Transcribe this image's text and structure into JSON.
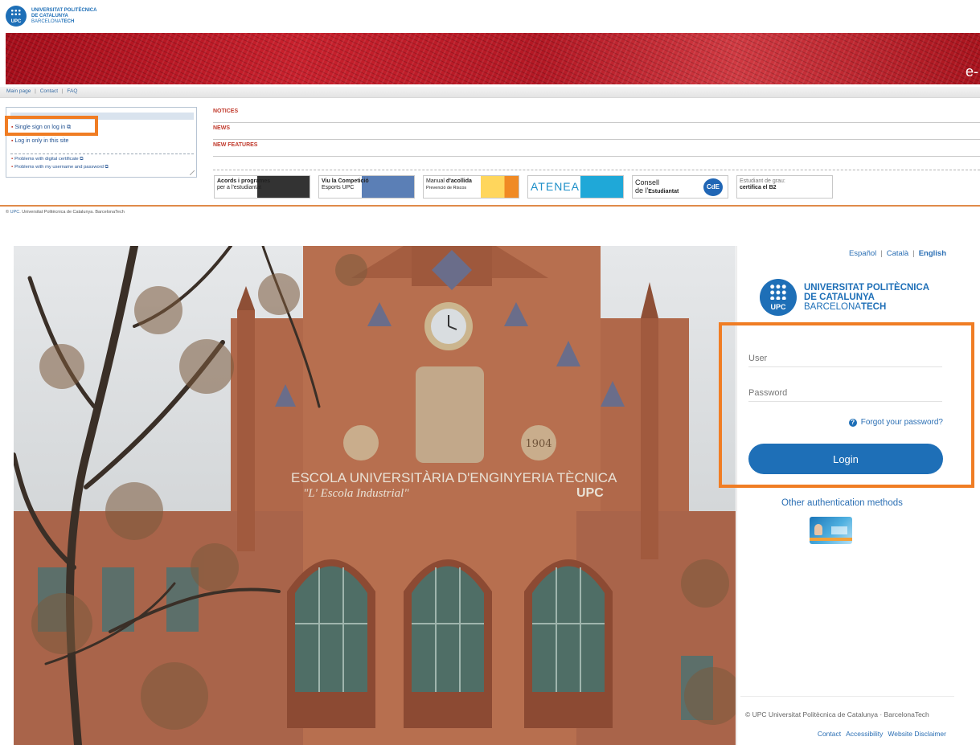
{
  "portal": {
    "logo": {
      "line1": "UNIVERSITAT POLITÈCNICA",
      "line2": "DE CATALUNYA",
      "line3a": "BARCELONA",
      "line3b": "TECH",
      "mark": "UPC"
    },
    "banner_text": "e-",
    "subnav": {
      "main": "Main page",
      "contact": "Contact",
      "faq": "FAQ",
      "sep": "|"
    },
    "login_box": {
      "sso": "Single sign on log in",
      "local": "Log in only in this site",
      "cert": "Problems with digital certificate",
      "userpass": "Problems with my username and password"
    },
    "sections": [
      "NOTICES",
      "NEWS",
      "NEW FEATURES"
    ],
    "promos": [
      {
        "line1": "Acords i programes",
        "line2": "per a l'estudiantat"
      },
      {
        "line1": "Viu la Competició",
        "line2": "Esports UPC"
      },
      {
        "line1a": "Manual ",
        "line1b": "d'acollida",
        "line2": "Prevenció de Riscos"
      },
      {
        "line1": "ATENEA"
      },
      {
        "line1": "Consell",
        "line2a": "de l'",
        "line2b": "Estudiantat",
        "badge": "CdE"
      },
      {
        "line1": "Estudiant de grau:",
        "line2": "certifica el B2"
      }
    ],
    "footer": {
      "upc": "UPC",
      "text": ". Universitat Politècnica de Catalunya. BarcelonaTech",
      "copy": "©"
    }
  },
  "photo": {
    "facade_line1": "ESCOLA UNIVERSITÀRIA D'ENGINYERIA TÈCNICA",
    "facade_line2": "\"L' Escola Industrial\"",
    "facade_upc": "UPC",
    "facade_year": "1904"
  },
  "cas": {
    "langs": {
      "es": "Español",
      "ca": "Català",
      "en": "English",
      "sep": "|"
    },
    "logo": {
      "line1": "UNIVERSITAT POLITÈCNICA",
      "line2": "DE CATALUNYA",
      "line3a": "BARCELONA",
      "line3b": "TECH",
      "mark": "UPC"
    },
    "user_placeholder": "User",
    "password_placeholder": "Password",
    "forgot": "Forgot your password?",
    "forgot_icon": "?",
    "login_label": "Login",
    "other_methods": "Other authentication methods",
    "footer_copy": "© UPC Universitat Politècnica de Catalunya · BarcelonaTech",
    "footer_links": [
      "Contact",
      "Accessibility",
      "Website Disclaimer"
    ]
  },
  "colors": {
    "accent": "#1e6fb7",
    "highlight": "#f07d24",
    "banner": "#b31824",
    "section_label": "#c0392b"
  }
}
